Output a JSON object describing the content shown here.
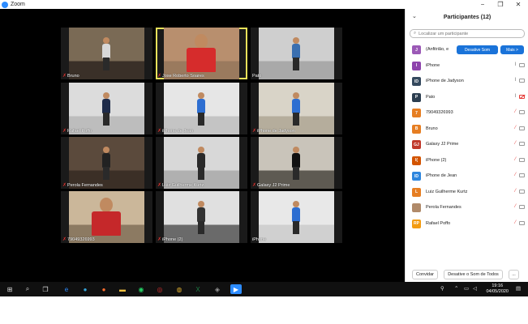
{
  "window": {
    "title": "Zoom",
    "minimize": "−",
    "restore": "❐",
    "close": "✕"
  },
  "tiles": [
    {
      "name": "Bruno",
      "wall": "#7a6a55",
      "floor": "#3a3028",
      "shirt": "#d8d8d8"
    },
    {
      "name": "Jose Roberto Soares",
      "wall": "#b88f6e",
      "floor": "#9a7a5e",
      "shirt": "#d62c2c"
    },
    {
      "name": "Pato",
      "wall": "#cfcfcf",
      "floor": "#a9a9a9",
      "shirt": "#3a6fb0"
    },
    {
      "name": "Rafael Poffo",
      "wall": "#dcdcdc",
      "floor": "#bdbdbd",
      "shirt": "#1e2b4a"
    },
    {
      "name": "iPhone de Jean",
      "wall": "#e6e6e6",
      "floor": "#c4c4c4",
      "shirt": "#2d6ed1"
    },
    {
      "name": "iPhone de Jadyson",
      "wall": "#d9d4c8",
      "floor": "#b5ad9c",
      "shirt": "#2d6ed1"
    },
    {
      "name": "Perola Fernandes",
      "wall": "#5b4a3c",
      "floor": "#3b2f26",
      "shirt": "#222222"
    },
    {
      "name": "Luiz Guilherme Kurtz",
      "wall": "#d8d8d8",
      "floor": "#b0b0b0",
      "shirt": "#2a2a2a"
    },
    {
      "name": "Galaxy J2 Prime",
      "wall": "#c9c4ba",
      "floor": "#5e5a52",
      "shirt": "#111111"
    },
    {
      "name": "79049326993",
      "wall": "#cbb79a",
      "floor": "#8c7a62",
      "shirt": "#c5282a"
    },
    {
      "name": "iPhone (2)",
      "wall": "#e0e0e0",
      "floor": "#6a6a6a",
      "shirt": "#333333"
    },
    {
      "name": "iPhone",
      "wall": "#e8e8e8",
      "floor": "#d0d0d0",
      "shirt": "#2d6ed1"
    }
  ],
  "panel": {
    "title": "Participantes (12)",
    "search_placeholder": "Localizar um participante",
    "host_mute_button": "Desative Som",
    "host_more_button": "Mais >",
    "participants": [
      {
        "name": "(Anfitrião, e",
        "initials": "J",
        "color": "#9b59b6"
      },
      {
        "name": "iPhone",
        "initials": "I",
        "color": "#8e44ad"
      },
      {
        "name": "iPhone de Jadyson",
        "initials": "ID",
        "color": "#34495e"
      },
      {
        "name": "Pato",
        "initials": "P",
        "color": "#2c3e50"
      },
      {
        "name": "79049326993",
        "initials": "7",
        "color": "#e67e22"
      },
      {
        "name": "Bruno",
        "initials": "B",
        "color": "#e67e22"
      },
      {
        "name": "Galaxy J2 Prime",
        "initials": "GJ",
        "color": "#c0392b"
      },
      {
        "name": "iPhone (2)",
        "initials": "I(",
        "color": "#d35400"
      },
      {
        "name": "iPhone de Jean",
        "initials": "ID",
        "color": "#2e86de"
      },
      {
        "name": "Luiz Guilherme Kurtz",
        "initials": "L",
        "color": "#e67e22"
      },
      {
        "name": "Perola Fernandes",
        "initials": "",
        "color": "#b08a6a"
      },
      {
        "name": "Rafael Poffo",
        "initials": "RP",
        "color": "#f39c12"
      }
    ],
    "invite_button": "Convidar",
    "mute_all_button": "Desative o Som de Todos",
    "more_button": "..."
  },
  "taskbar": {
    "time": "19:16",
    "date": "04/05/2020"
  }
}
